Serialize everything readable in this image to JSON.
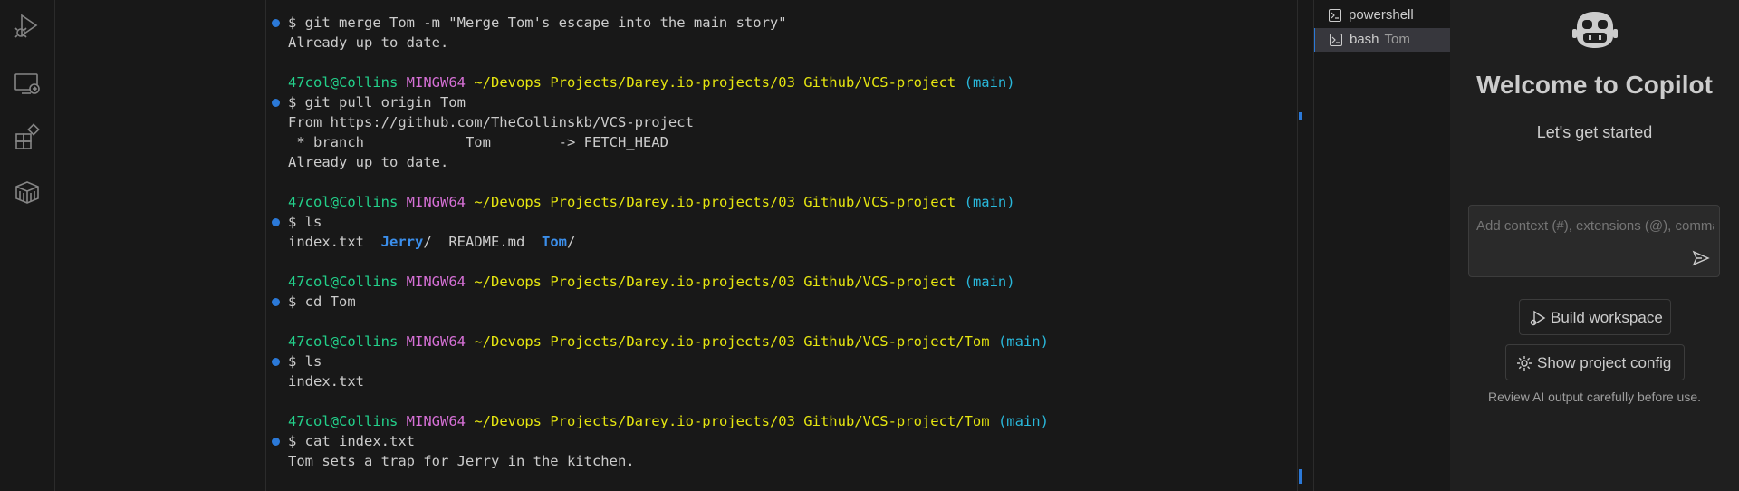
{
  "activity_bar": {
    "items": [
      {
        "name": "run-debug-icon"
      },
      {
        "name": "remote-explorer-icon"
      },
      {
        "name": "extensions-icon"
      },
      {
        "name": "packages-icon"
      }
    ]
  },
  "terminal": {
    "lines": [
      {
        "dot": true,
        "segments": [
          {
            "t": "$ git merge Tom -m \"Merge Tom's escape into the main story\"",
            "c": ""
          }
        ]
      },
      {
        "dot": false,
        "segments": [
          {
            "t": "Already up to date.",
            "c": ""
          }
        ]
      },
      {
        "dot": false,
        "segments": []
      },
      {
        "dot": false,
        "segments": [
          {
            "t": "47col@Collins",
            "c": "c-user"
          },
          {
            "t": " ",
            "c": ""
          },
          {
            "t": "MINGW64",
            "c": "c-host"
          },
          {
            "t": " ",
            "c": ""
          },
          {
            "t": "~/Devops Projects/Darey.io-projects/03 Github/VCS-project",
            "c": "c-path"
          },
          {
            "t": " ",
            "c": ""
          },
          {
            "t": "(main)",
            "c": "c-branch"
          }
        ]
      },
      {
        "dot": true,
        "segments": [
          {
            "t": "$ git pull origin Tom",
            "c": ""
          }
        ]
      },
      {
        "dot": false,
        "segments": [
          {
            "t": "From https://github.com/TheCollinskb/VCS-project",
            "c": ""
          }
        ]
      },
      {
        "dot": false,
        "segments": [
          {
            "t": " * branch            Tom        -> FETCH_HEAD",
            "c": ""
          }
        ]
      },
      {
        "dot": false,
        "segments": [
          {
            "t": "Already up to date.",
            "c": ""
          }
        ]
      },
      {
        "dot": false,
        "segments": []
      },
      {
        "dot": false,
        "segments": [
          {
            "t": "47col@Collins",
            "c": "c-user"
          },
          {
            "t": " ",
            "c": ""
          },
          {
            "t": "MINGW64",
            "c": "c-host"
          },
          {
            "t": " ",
            "c": ""
          },
          {
            "t": "~/Devops Projects/Darey.io-projects/03 Github/VCS-project",
            "c": "c-path"
          },
          {
            "t": " ",
            "c": ""
          },
          {
            "t": "(main)",
            "c": "c-branch"
          }
        ]
      },
      {
        "dot": true,
        "segments": [
          {
            "t": "$ ls",
            "c": ""
          }
        ]
      },
      {
        "dot": false,
        "segments": [
          {
            "t": "index.txt  ",
            "c": ""
          },
          {
            "t": "Jerry",
            "c": "c-dir"
          },
          {
            "t": "/  README.md  ",
            "c": ""
          },
          {
            "t": "Tom",
            "c": "c-dir"
          },
          {
            "t": "/",
            "c": ""
          }
        ]
      },
      {
        "dot": false,
        "segments": []
      },
      {
        "dot": false,
        "segments": [
          {
            "t": "47col@Collins",
            "c": "c-user"
          },
          {
            "t": " ",
            "c": ""
          },
          {
            "t": "MINGW64",
            "c": "c-host"
          },
          {
            "t": " ",
            "c": ""
          },
          {
            "t": "~/Devops Projects/Darey.io-projects/03 Github/VCS-project",
            "c": "c-path"
          },
          {
            "t": " ",
            "c": ""
          },
          {
            "t": "(main)",
            "c": "c-branch"
          }
        ]
      },
      {
        "dot": true,
        "segments": [
          {
            "t": "$ cd Tom",
            "c": ""
          }
        ]
      },
      {
        "dot": false,
        "segments": []
      },
      {
        "dot": false,
        "segments": [
          {
            "t": "47col@Collins",
            "c": "c-user"
          },
          {
            "t": " ",
            "c": ""
          },
          {
            "t": "MINGW64",
            "c": "c-host"
          },
          {
            "t": " ",
            "c": ""
          },
          {
            "t": "~/Devops Projects/Darey.io-projects/03 Github/VCS-project/Tom",
            "c": "c-path"
          },
          {
            "t": " ",
            "c": ""
          },
          {
            "t": "(main)",
            "c": "c-branch"
          }
        ]
      },
      {
        "dot": true,
        "segments": [
          {
            "t": "$ ls",
            "c": ""
          }
        ]
      },
      {
        "dot": false,
        "segments": [
          {
            "t": "index.txt",
            "c": ""
          }
        ]
      },
      {
        "dot": false,
        "segments": []
      },
      {
        "dot": false,
        "segments": [
          {
            "t": "47col@Collins",
            "c": "c-user"
          },
          {
            "t": " ",
            "c": ""
          },
          {
            "t": "MINGW64",
            "c": "c-host"
          },
          {
            "t": " ",
            "c": ""
          },
          {
            "t": "~/Devops Projects/Darey.io-projects/03 Github/VCS-project/Tom",
            "c": "c-path"
          },
          {
            "t": " ",
            "c": ""
          },
          {
            "t": "(main)",
            "c": "c-branch"
          }
        ]
      },
      {
        "dot": true,
        "segments": [
          {
            "t": "$ cat index.txt",
            "c": ""
          }
        ]
      },
      {
        "dot": false,
        "segments": [
          {
            "t": "Tom sets a trap for Jerry in the kitchen.",
            "c": ""
          }
        ]
      }
    ]
  },
  "terminal_tabs": [
    {
      "label": "powershell",
      "desc": "",
      "active": false
    },
    {
      "label": "bash",
      "desc": "Tom",
      "active": true
    }
  ],
  "copilot": {
    "title": "Welcome to Copilot",
    "subtitle": "Let's get started",
    "input_placeholder": "Add context (#), extensions (@), commands (/)",
    "build_workspace_label": "Build workspace",
    "show_project_config_label": "Show project config",
    "note": "Review AI output carefully before use."
  },
  "colors": {
    "accent": "#2b79d8",
    "prompt_user": "#23d18b",
    "prompt_host": "#d670d6",
    "prompt_path": "#e5e510",
    "prompt_branch": "#29b8db"
  }
}
